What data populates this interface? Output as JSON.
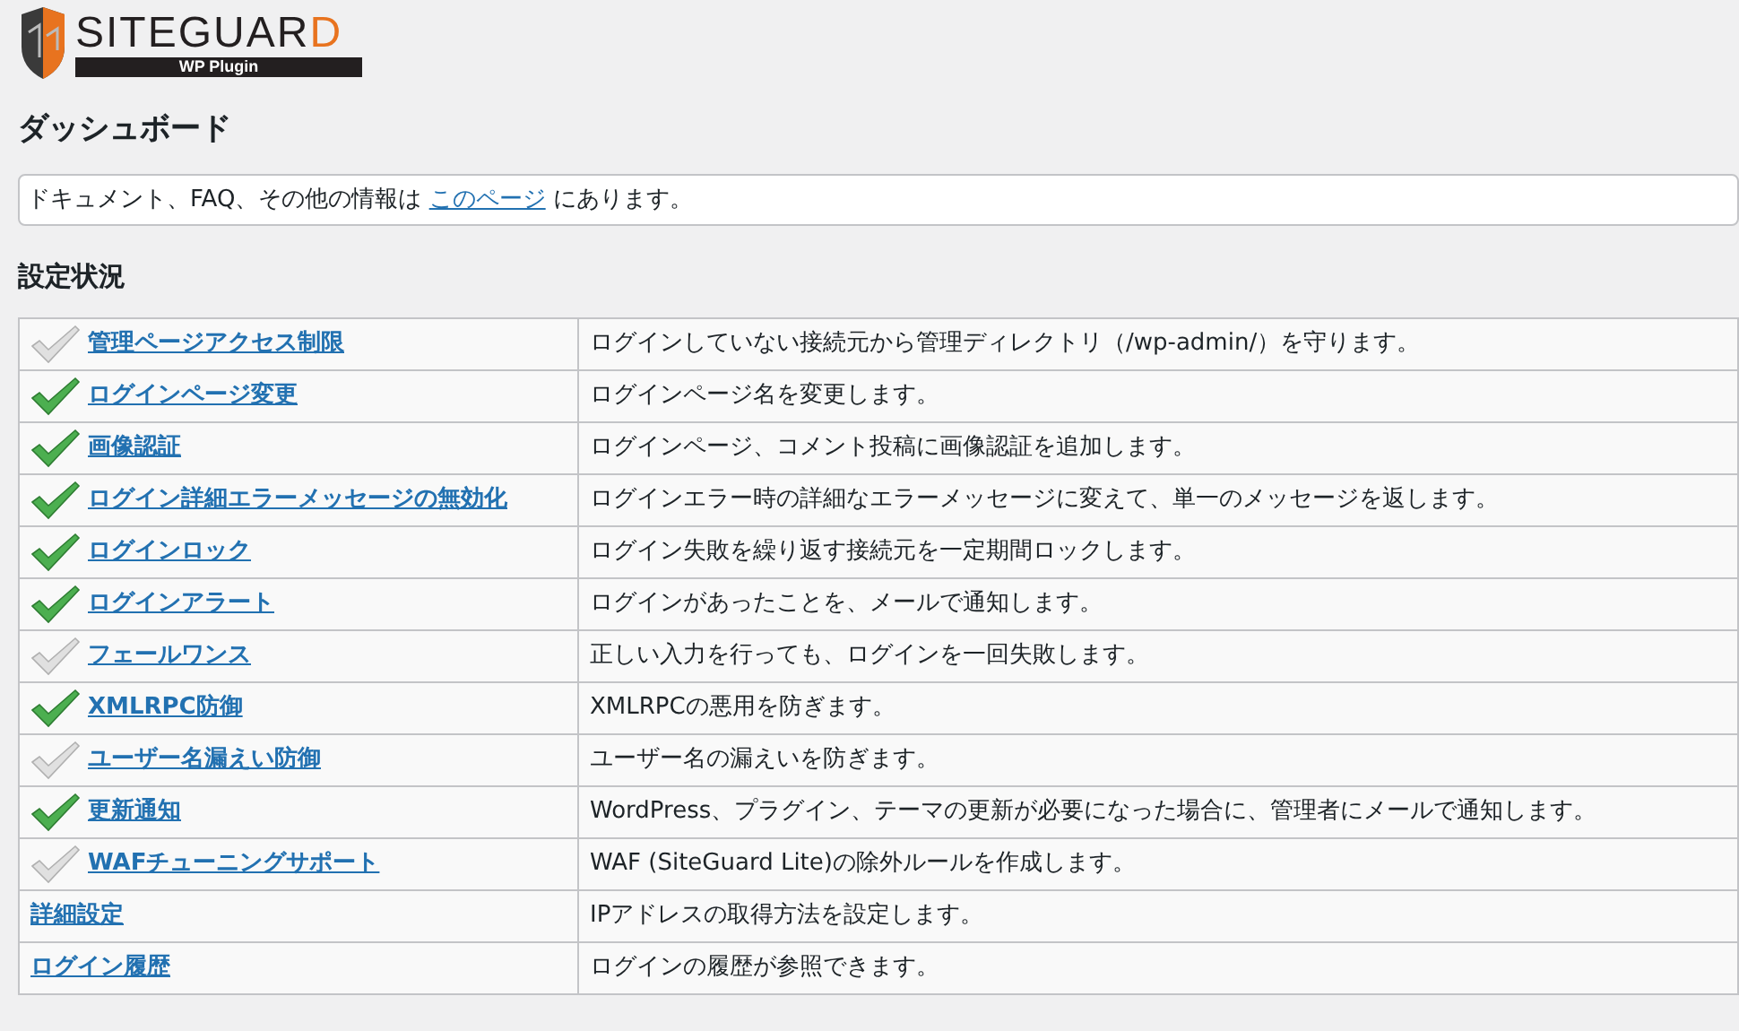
{
  "logo": {
    "title": "SITEGUARD",
    "subtitle": "WP Plugin"
  },
  "page_title": "ダッシュボード",
  "notice": {
    "before": "ドキュメント、FAQ、その他の情報は",
    "link": "このページ",
    "after": "にあります。"
  },
  "section_title": "設定状況",
  "table": {
    "rows": [
      {
        "kind": "feature",
        "on": false,
        "name": "管理ページアクセス制限",
        "description": "ログインしていない接続元から管理ディレクトリ（/wp-admin/）を守ります。"
      },
      {
        "kind": "feature",
        "on": true,
        "name": "ログインページ変更",
        "description": "ログインページ名を変更します。"
      },
      {
        "kind": "feature",
        "on": true,
        "name": "画像認証",
        "description": "ログインページ、コメント投稿に画像認証を追加します。"
      },
      {
        "kind": "feature",
        "on": true,
        "name": "ログイン詳細エラーメッセージの無効化",
        "description": "ログインエラー時の詳細なエラーメッセージに変えて、単一のメッセージを返します。"
      },
      {
        "kind": "feature",
        "on": true,
        "name": "ログインロック",
        "description": "ログイン失敗を繰り返す接続元を一定期間ロックします。"
      },
      {
        "kind": "feature",
        "on": true,
        "name": "ログインアラート",
        "description": "ログインがあったことを、メールで通知します。"
      },
      {
        "kind": "feature",
        "on": false,
        "name": "フェールワンス",
        "description": "正しい入力を行っても、ログインを一回失敗します。"
      },
      {
        "kind": "feature",
        "on": true,
        "name": "XMLRPC防御",
        "description": "XMLRPCの悪用を防ぎます。"
      },
      {
        "kind": "feature",
        "on": false,
        "name": "ユーザー名漏えい防御",
        "description": "ユーザー名の漏えいを防ぎます。"
      },
      {
        "kind": "feature",
        "on": true,
        "name": "更新通知",
        "description": "WordPress、プラグイン、テーマの更新が必要になった場合に、管理者にメールで通知します。"
      },
      {
        "kind": "feature",
        "on": false,
        "name": "WAFチューニングサポート",
        "description": "WAF (SiteGuard Lite)の除外ルールを作成します。"
      },
      {
        "kind": "plain",
        "name": "詳細設定",
        "description": "IPアドレスの取得方法を設定します。"
      },
      {
        "kind": "plain",
        "name": "ログイン履歴",
        "description": "ログインの履歴が参照できます。"
      }
    ]
  }
}
